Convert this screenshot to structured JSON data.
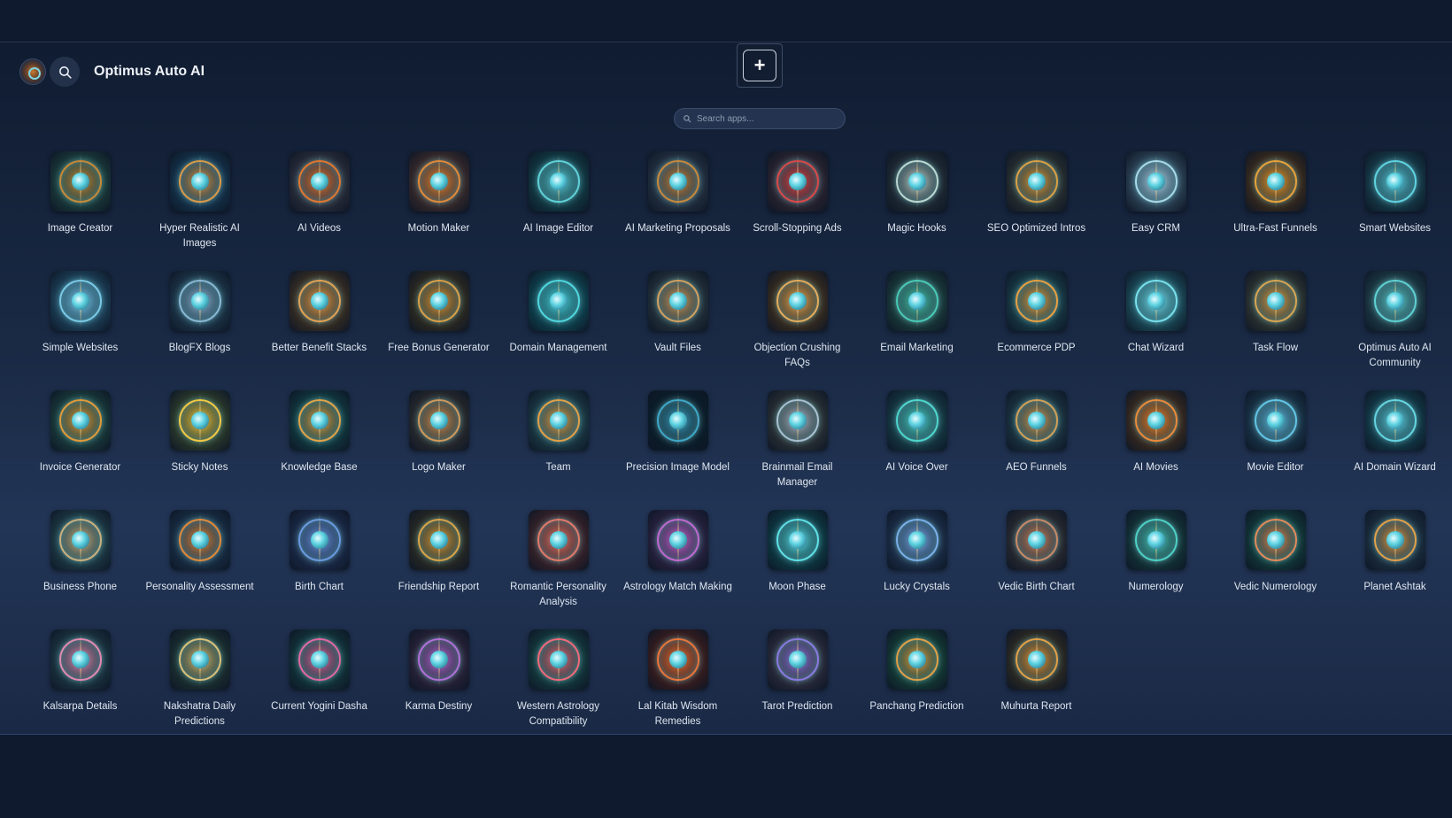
{
  "header": {
    "title": "Optimus Auto AI"
  },
  "add_button": {
    "label": "+"
  },
  "search": {
    "placeholder": "Search apps..."
  },
  "apps": [
    {
      "label": "Image Creator",
      "icon": "image-creator-icon",
      "colors": [
        "#1b3a3a",
        "#c58a3a"
      ]
    },
    {
      "label": "Hyper Realistic AI Images",
      "icon": "camera-lens-icon",
      "colors": [
        "#15324a",
        "#d89a48"
      ]
    },
    {
      "label": "AI Videos",
      "icon": "video-reel-icon",
      "colors": [
        "#2b2d3a",
        "#e0772f"
      ]
    },
    {
      "label": "Motion Maker",
      "icon": "motion-camera-icon",
      "colors": [
        "#3a2a2a",
        "#e08a3a"
      ]
    },
    {
      "label": "AI Image Editor",
      "icon": "image-editor-icon",
      "colors": [
        "#123a44",
        "#5fd0d8"
      ]
    },
    {
      "label": "AI Marketing Proposals",
      "icon": "proposal-gem-icon",
      "colors": [
        "#243040",
        "#c7883c"
      ]
    },
    {
      "label": "Scroll-Stopping Ads",
      "icon": "ads-eye-icon",
      "colors": [
        "#2c2430",
        "#d94a4a"
      ]
    },
    {
      "label": "Magic Hooks",
      "icon": "magic-hook-icon",
      "colors": [
        "#202a33",
        "#b9d6d0"
      ]
    },
    {
      "label": "SEO Optimized Intros",
      "icon": "seo-badge-icon",
      "colors": [
        "#2a3030",
        "#d8a045"
      ]
    },
    {
      "label": "Easy CRM",
      "icon": "crm-hexagon-icon",
      "colors": [
        "#2c4255",
        "#a7d8e8"
      ]
    },
    {
      "label": "Ultra-Fast Funnels",
      "icon": "funnel-bolt-icon",
      "colors": [
        "#3a2a1c",
        "#e6a23a"
      ]
    },
    {
      "label": "Smart Websites",
      "icon": "globe-icon",
      "colors": [
        "#163a48",
        "#5fd2e0"
      ]
    },
    {
      "label": "Simple Websites",
      "icon": "monitor-icon",
      "colors": [
        "#1d4058",
        "#79c8e6"
      ]
    },
    {
      "label": "BlogFX Blogs",
      "icon": "pen-nib-icon",
      "colors": [
        "#1d3548",
        "#8ab8d4"
      ]
    },
    {
      "label": "Better Benefit Stacks",
      "icon": "pyramid-stack-icon",
      "colors": [
        "#3a2e22",
        "#e0a255"
      ]
    },
    {
      "label": "Free Bonus Generator",
      "icon": "gift-box-icon",
      "colors": [
        "#2f2a20",
        "#d9a048"
      ]
    },
    {
      "label": "Domain Management",
      "icon": "domain-com-icon",
      "colors": [
        "#0f4450",
        "#4fd6de"
      ]
    },
    {
      "label": "Vault Files",
      "icon": "vault-icon",
      "colors": [
        "#24313a",
        "#d0a060"
      ]
    },
    {
      "label": "Objection Crushing FAQs",
      "icon": "question-mark-icon",
      "colors": [
        "#3a2c1e",
        "#e2ac5c"
      ]
    },
    {
      "label": "Email Marketing",
      "icon": "envelope-icon",
      "colors": [
        "#1a3a3a",
        "#49c9b5"
      ]
    },
    {
      "label": "Ecommerce PDP",
      "icon": "product-page-icon",
      "colors": [
        "#183a44",
        "#e6a042"
      ]
    },
    {
      "label": "Chat Wizard",
      "icon": "chat-bot-icon",
      "colors": [
        "#1c4a58",
        "#76e0ec"
      ]
    },
    {
      "label": "Task Flow",
      "icon": "task-grid-icon",
      "colors": [
        "#2e3430",
        "#d6a552"
      ]
    },
    {
      "label": "Optimus Auto AI Community",
      "icon": "community-network-icon",
      "colors": [
        "#1d3a44",
        "#5ed0d2"
      ]
    },
    {
      "label": "Invoice Generator",
      "icon": "invoice-dollar-icon",
      "colors": [
        "#1a3a3a",
        "#e09a3a"
      ]
    },
    {
      "label": "Sticky Notes",
      "icon": "sticky-note-icon",
      "colors": [
        "#2c3a2a",
        "#f0c844"
      ]
    },
    {
      "label": "Knowledge Base",
      "icon": "book-icon",
      "colors": [
        "#12383e",
        "#e0a448"
      ]
    },
    {
      "label": "Logo Maker",
      "icon": "logo-compass-icon",
      "colors": [
        "#2a2a2c",
        "#cf9a5c"
      ]
    },
    {
      "label": "Team",
      "icon": "team-people-icon",
      "colors": [
        "#1c3a44",
        "#e0a048"
      ]
    },
    {
      "label": "Precision Image Model",
      "icon": "precision-lens-icon",
      "colors": [
        "#0c1e2a",
        "#3fa8c8"
      ]
    },
    {
      "label": "Brainmail Email Manager",
      "icon": "brain-envelope-icon",
      "colors": [
        "#2a3034",
        "#a8c0d0"
      ]
    },
    {
      "label": "AI Voice Over",
      "icon": "microphone-icon",
      "colors": [
        "#163a44",
        "#4ed6cc"
      ]
    },
    {
      "label": "AEO Funnels",
      "icon": "aeo-funnel-icon",
      "colors": [
        "#1c3440",
        "#d0a058"
      ]
    },
    {
      "label": "AI Movies",
      "icon": "film-reel-icon",
      "colors": [
        "#3a2a1e",
        "#e88a3a"
      ]
    },
    {
      "label": "Movie Editor",
      "icon": "scissors-film-icon",
      "colors": [
        "#1a3448",
        "#62c4e4"
      ]
    },
    {
      "label": "AI Domain Wizard",
      "icon": "domain-wizard-icon",
      "colors": [
        "#133a48",
        "#64d4e0"
      ]
    },
    {
      "label": "Business Phone",
      "icon": "phone-icon",
      "colors": [
        "#1e3a44",
        "#c8b080"
      ]
    },
    {
      "label": "Personality Assessment",
      "icon": "persona-icon",
      "colors": [
        "#1a2e44",
        "#e08a3a"
      ]
    },
    {
      "label": "Birth Chart",
      "icon": "birth-chart-icon",
      "colors": [
        "#1c2a48",
        "#6a9ae0"
      ]
    },
    {
      "label": "Friendship Report",
      "icon": "friendship-icon",
      "colors": [
        "#2a2a22",
        "#d8a448"
      ]
    },
    {
      "label": "Romantic Personality Analysis",
      "icon": "heart-icon",
      "colors": [
        "#3a2228",
        "#e07a6a"
      ]
    },
    {
      "label": "Astrology Match Making",
      "icon": "match-rings-icon",
      "colors": [
        "#2a2240",
        "#c06ad0"
      ]
    },
    {
      "label": "Moon Phase",
      "icon": "moon-icon",
      "colors": [
        "#0e3a44",
        "#5ee0e6"
      ]
    },
    {
      "label": "Lucky Crystals",
      "icon": "crystal-icon",
      "colors": [
        "#1c2e48",
        "#7ab0ea"
      ]
    },
    {
      "label": "Vedic Birth Chart",
      "icon": "vedic-chart-icon",
      "colors": [
        "#2a2a30",
        "#c88a68"
      ]
    },
    {
      "label": "Numerology",
      "icon": "numerology-icon",
      "colors": [
        "#143438",
        "#4ed0c4"
      ]
    },
    {
      "label": "Vedic Numerology",
      "icon": "vedic-numerology-icon",
      "colors": [
        "#123838",
        "#e08a5a"
      ]
    },
    {
      "label": "Planet Ashtak",
      "icon": "planet-icon",
      "colors": [
        "#1c2e3e",
        "#e0a04a"
      ]
    },
    {
      "label": "Kalsarpa Details",
      "icon": "lotus-icon",
      "colors": [
        "#1c3440",
        "#e08ab0"
      ]
    },
    {
      "label": "Nakshatra Daily Predictions",
      "icon": "star-compass-icon",
      "colors": [
        "#1c3030",
        "#d8c07a"
      ]
    },
    {
      "label": "Current Yogini Dasha",
      "icon": "yogini-lotus-icon",
      "colors": [
        "#13343a",
        "#e068a0"
      ]
    },
    {
      "label": "Karma Destiny",
      "icon": "karma-heart-icon",
      "colors": [
        "#2a2238",
        "#b070d8"
      ]
    },
    {
      "label": "Western Astrology Compatibility",
      "icon": "compatibility-heart-icon",
      "colors": [
        "#14383c",
        "#ee6a7a"
      ]
    },
    {
      "label": "Lal Kitab Wisdom Remedies",
      "icon": "lal-kitab-icon",
      "colors": [
        "#3a1c1c",
        "#e8763a"
      ]
    },
    {
      "label": "Tarot Prediction",
      "icon": "tarot-eye-icon",
      "colors": [
        "#2a2a3a",
        "#8a7ae0"
      ]
    },
    {
      "label": "Panchang Prediction",
      "icon": "panchang-icon",
      "colors": [
        "#143a34",
        "#e0a048"
      ]
    },
    {
      "label": "Muhurta Report",
      "icon": "muhurta-icon",
      "colors": [
        "#2e2a22",
        "#e0a048"
      ]
    }
  ]
}
